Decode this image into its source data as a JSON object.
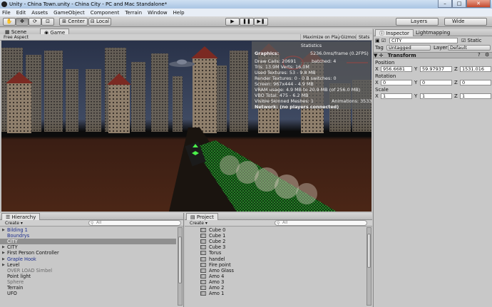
{
  "window": {
    "title": "Unity - China Town.unity - China City - PC and Mac Standalone*",
    "min": "–",
    "max": "□",
    "close": "✕"
  },
  "menu": [
    "File",
    "Edit",
    "Assets",
    "GameObject",
    "Component",
    "Terrain",
    "Window",
    "Help"
  ],
  "toolbar": {
    "pivot_label": "Center",
    "space_label": "Local",
    "layers_label": "Layers",
    "layout_label": "Wide",
    "play": "▶",
    "pause": "❚❚",
    "step": "▶❚"
  },
  "scene_tabs": {
    "scene": "Scene",
    "game": "Game"
  },
  "game_bar": {
    "aspect": "Free Aspect",
    "maximize": "Maximize on Play",
    "gizmos": "Gizmos",
    "stats": "Stats"
  },
  "stats": {
    "title": "Statistics",
    "graphics_label": "Graphics:",
    "frame_time": "5236.0ms/frame (0.2FPS)",
    "draw_calls": "Draw Calls: 20691",
    "batched": "batched: 4",
    "tris": "Tris: 13.9M  Verts: 16.0M",
    "textures": "Used Textures: 53 - 9.8 MB",
    "render_textures": "Render Textures: 0 - 0 B  switches: 0",
    "screen": "Screen: 967x444 - 4.9 MB",
    "vram": "VRAM usage: 4.9 MB to 20.9 MB (of 256.0 MB)",
    "vbo": "VBO Total: 475 - 6.2 MB",
    "skinned": "Visible Skinned Meshes: 1",
    "animations": "Animations: 3533",
    "network": "Network: (no players connected)"
  },
  "inspector": {
    "tab_inspector": "Inspector",
    "tab_lightmapping": "Lightmapping",
    "object_name": "CITY",
    "static_label": "Static",
    "tag_label": "Tag",
    "tag_value": "Untagged",
    "layer_label": "Layer",
    "layer_value": "Default",
    "component": "Transform",
    "position_label": "Position",
    "rotation_label": "Rotation",
    "scale_label": "Scale",
    "position": {
      "x": "956.6681",
      "y": "59.97937",
      "z": "1531.016"
    },
    "rotation": {
      "x": "0",
      "y": "0",
      "z": "0"
    },
    "scale": {
      "x": "1",
      "y": "1",
      "z": "1"
    },
    "axis_x": "X",
    "axis_y": "Y",
    "axis_z": "Z"
  },
  "hierarchy": {
    "title": "Hierarchy",
    "create": "Create ▾",
    "search_placeholder": "All",
    "items": [
      {
        "label": "Bilding 1",
        "expand": "▶",
        "style": "prefab"
      },
      {
        "label": "Boundrys",
        "expand": "",
        "style": "prefab"
      },
      {
        "label": "CITY",
        "expand": "",
        "style": "sel"
      },
      {
        "label": "CITY",
        "expand": "▶",
        "style": ""
      },
      {
        "label": "First Person Controller",
        "expand": "▶",
        "style": ""
      },
      {
        "label": "Graple Hook",
        "expand": "▶",
        "style": "prefab"
      },
      {
        "label": "Level",
        "expand": "▶",
        "style": ""
      },
      {
        "label": "OVER LOAD Simbel",
        "expand": "",
        "style": "grey"
      },
      {
        "label": "Point light",
        "expand": "",
        "style": ""
      },
      {
        "label": "Sphere",
        "expand": "",
        "style": "grey"
      },
      {
        "label": "Terrain",
        "expand": "",
        "style": ""
      },
      {
        "label": "UFO",
        "expand": "",
        "style": ""
      }
    ]
  },
  "project": {
    "title": "Project",
    "create": "Create ▾",
    "search_placeholder": "All",
    "items": [
      "Cube 0",
      "Cube 1",
      "Cube 2",
      "Cube 3",
      "Torus",
      "handel",
      "Fire point",
      "Amo Glass",
      "Amo 4",
      "Amo 3",
      "Amo 2",
      "Amo 1"
    ]
  }
}
